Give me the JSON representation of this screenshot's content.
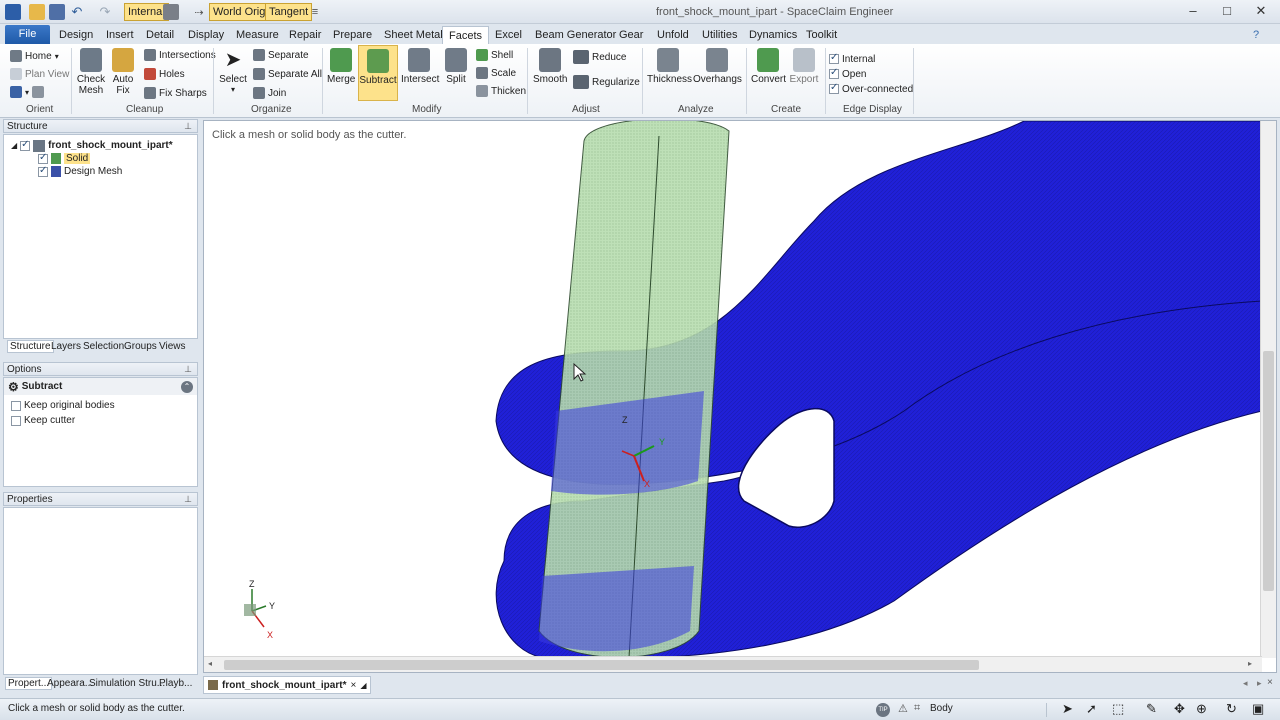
{
  "window": {
    "title": "front_shock_mount_ipart - SpaceClaim Engineer",
    "toggles": {
      "internal": "Internal",
      "world_origin": "World Origin",
      "tangent": "Tangent"
    }
  },
  "tabs": [
    "File",
    "Design",
    "Insert",
    "Detail",
    "Display",
    "Measure",
    "Repair",
    "Prepare",
    "Sheet Metal",
    "Facets",
    "Excel",
    "Beam Generator",
    "Gear",
    "Unfold",
    "Utilities",
    "Dynamics",
    "Toolkit"
  ],
  "active_tab": "Facets",
  "ribbon": {
    "orient": {
      "label": "Orient",
      "home": "Home",
      "plan_view": "Plan View"
    },
    "cleanup": {
      "label": "Cleanup",
      "check_mesh": "Check Mesh",
      "auto_fix": "Auto Fix",
      "intersections": "Intersections",
      "holes": "Holes",
      "fix_sharps": "Fix Sharps"
    },
    "organize": {
      "label": "Organize",
      "select": "Select",
      "separate": "Separate",
      "separate_all": "Separate All",
      "join": "Join"
    },
    "modify": {
      "label": "Modify",
      "merge": "Merge",
      "subtract": "Subtract",
      "intersect": "Intersect",
      "split": "Split",
      "shell": "Shell",
      "scale": "Scale",
      "thicken": "Thicken"
    },
    "adjust": {
      "label": "Adjust",
      "smooth": "Smooth",
      "reduce": "Reduce",
      "regularize": "Regularize"
    },
    "analyze": {
      "label": "Analyze",
      "thickness": "Thickness",
      "overhangs": "Overhangs"
    },
    "create": {
      "label": "Create",
      "convert": "Convert",
      "export": "Export"
    },
    "edge_display": {
      "label": "Edge Display",
      "internal": "Internal",
      "open": "Open",
      "over_connected": "Over-connected"
    }
  },
  "structure": {
    "title": "Structure",
    "root": "front_shock_mount_ipart*",
    "items": [
      "Solid",
      "Design Mesh"
    ],
    "tabs": [
      "Structure",
      "Layers",
      "Selection",
      "Groups",
      "Views"
    ]
  },
  "options": {
    "title": "Options",
    "tool": "Subtract",
    "keep_original": "Keep original bodies",
    "keep_cutter": "Keep cutter"
  },
  "properties": {
    "title": "Properties"
  },
  "bottom_tabs": [
    "Propert...",
    "Appeara...",
    "Simulation Stru...",
    "Playb..."
  ],
  "viewport": {
    "hint": "Click a mesh or solid body as the cutter.",
    "axes": {
      "x": "X",
      "y": "Y",
      "z": "Z"
    }
  },
  "doc_tab": "front_shock_mount_ipart*",
  "status": {
    "message": "Click a mesh or solid body as the cutter.",
    "selection": "Body"
  },
  "colors": {
    "mesh_blue": "#1f1fd6",
    "cutter_green": "#b9dcae",
    "accent_yellow": "#fde28b",
    "file_blue": "#2563b3"
  }
}
